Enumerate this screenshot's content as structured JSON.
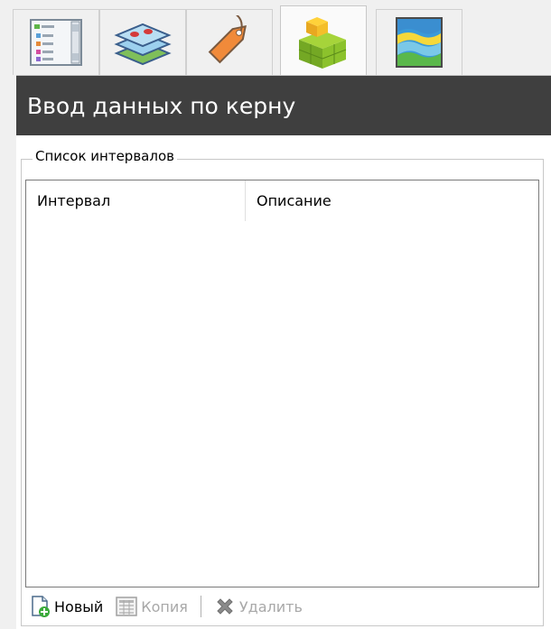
{
  "tabs": [
    {
      "name": "form-icon"
    },
    {
      "name": "layers-icon"
    },
    {
      "name": "tag-icon"
    },
    {
      "name": "cubes-icon",
      "active": true
    },
    {
      "name": "strata-icon"
    }
  ],
  "header": {
    "title": "Ввод данных по керну"
  },
  "group": {
    "legend": "Список интервалов"
  },
  "grid": {
    "columns": [
      "Интервал",
      "Описание"
    ]
  },
  "toolbar": {
    "new_label": "Новый",
    "copy_label": "Копия",
    "delete_label": "Удалить"
  },
  "colors": {
    "header_bg": "#3f3f3f",
    "disabled_text": "#a8a8a8"
  }
}
